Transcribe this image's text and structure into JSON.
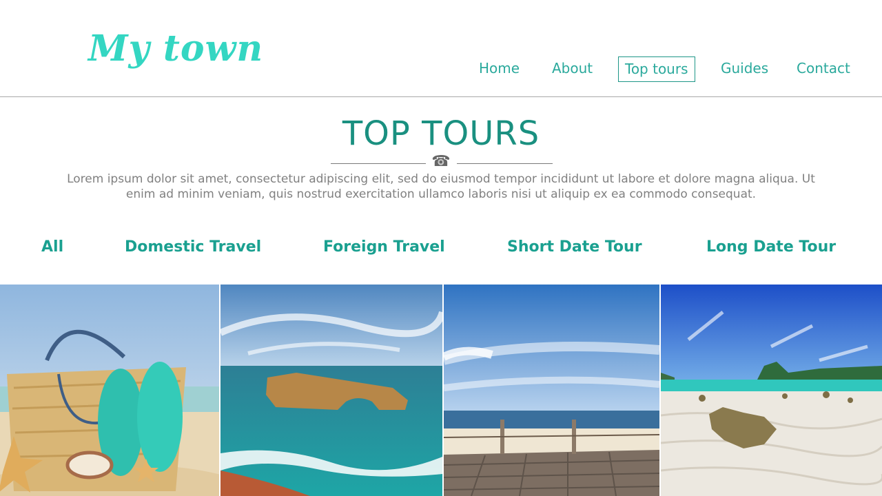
{
  "brand": {
    "logo": "My town"
  },
  "nav": {
    "items": [
      {
        "label": "Home"
      },
      {
        "label": "About"
      },
      {
        "label": "Top tours"
      },
      {
        "label": "Guides"
      },
      {
        "label": "Contact"
      }
    ],
    "active": "Top tours"
  },
  "section": {
    "title": "TOP TOURS",
    "icon": "phone-icon",
    "intro": "Lorem ipsum dolor sit amet, consectetur adipiscing elit, sed do eiusmod tempor incididunt ut labore et dolore magna aliqua. Ut enim ad minim veniam, quis nostrud exercitation ullamco laboris nisi ut aliquip ex ea commodo consequat."
  },
  "filters": [
    {
      "label": "All"
    },
    {
      "label": "Domestic Travel"
    },
    {
      "label": "Foreign Travel"
    },
    {
      "label": "Short Date Tour"
    },
    {
      "label": "Long Date Tour"
    }
  ],
  "colors": {
    "accent": "#1a9080",
    "logo": "#34d6c2",
    "nav_text": "#2aa99c",
    "body_text": "#808080",
    "divider": "#a8a8a8"
  }
}
